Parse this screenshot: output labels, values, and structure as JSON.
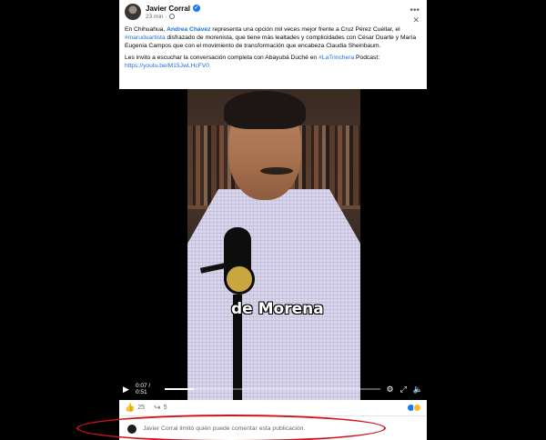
{
  "post": {
    "author": "Javier Corral",
    "verified_mark": "✓",
    "time": "23 min",
    "meta_separator": "·",
    "paragraph1": {
      "part1": "En Chihuahua, ",
      "mention": "Andrea Chávez",
      "part2": " representa una opción mil veces mejor frente a Cruz Pérez Cuéllar, el ",
      "hashtag": "#maruduartista",
      "part3": " disfrazado de morenista, que tiene más lealtades y complicidades con César Duarte y María Eugenia Campos que con el movimiento de transformación que encabeza Claudia Sheinbaum."
    },
    "paragraph2": {
      "part1": "Les invito a escuchar la conversación completa con Abayubá Duché en ",
      "hashtag": "#LaTrinchera",
      "part2": " Podcast:",
      "url": "https://youtu.be/M15JwLHcFV0"
    }
  },
  "video": {
    "caption": "de Morena",
    "current_time": "0:07",
    "duration": "0:51",
    "time_label": "0:07 / 0:51",
    "progress": 0.137
  },
  "actions": {
    "likes": "25",
    "shares": "5"
  },
  "comment_notice": "Javier Corral limitó quién puede comentar esta publicación.",
  "icons": {
    "more": "more-options-icon",
    "close": "close-icon",
    "play": "play-icon",
    "settings": "gear-icon",
    "fullscreen": "fullscreen-icon",
    "volume": "volume-icon",
    "like": "thumbs-up-icon",
    "share": "share-icon"
  },
  "colors": {
    "link": "#216fdb",
    "verified": "#1877f2",
    "highlight": "#d0131a"
  }
}
